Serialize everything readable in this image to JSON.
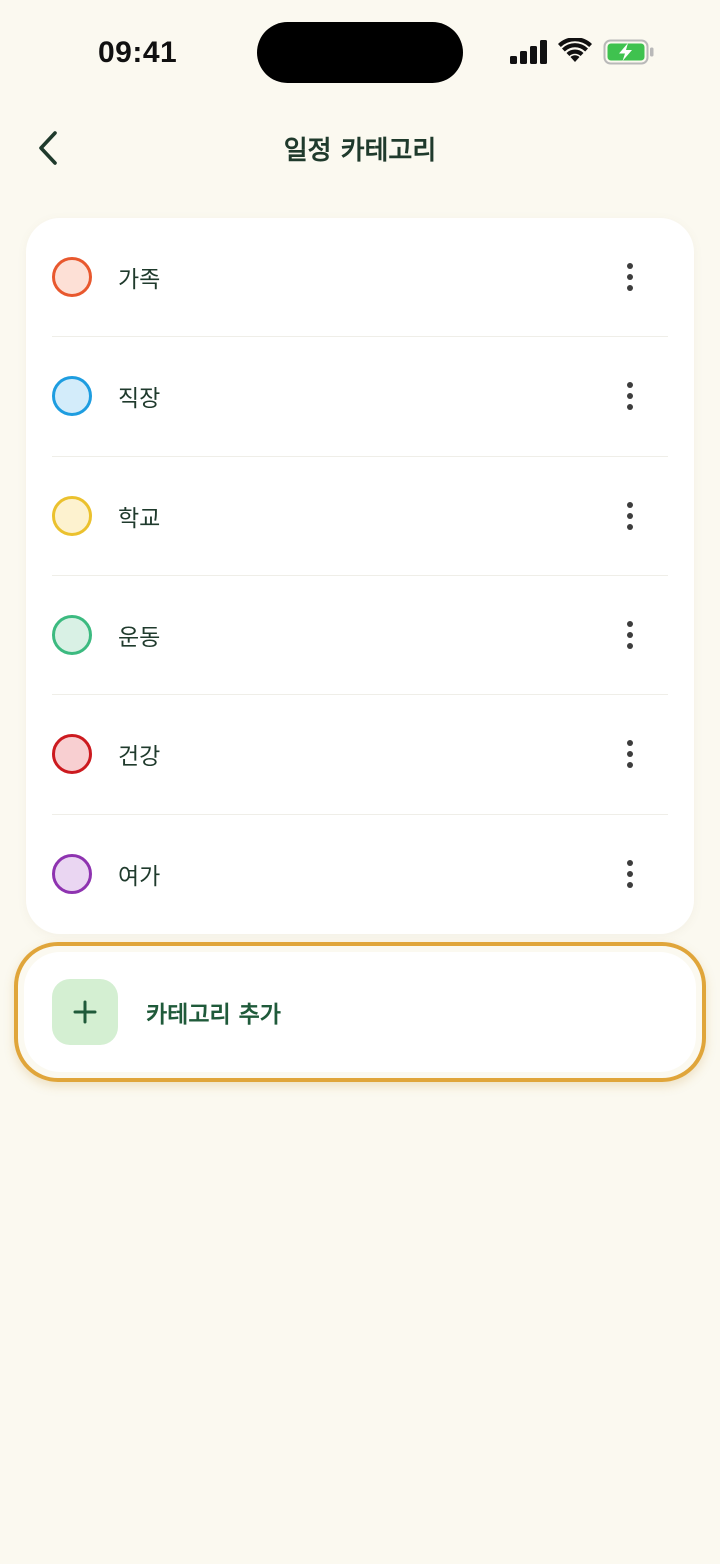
{
  "status_bar": {
    "time": "09:41",
    "icons": [
      "cellular-signal-icon",
      "wifi-icon",
      "battery-charging-icon"
    ]
  },
  "header": {
    "title": "일정 카테고리",
    "back_icon": "chevron-left-icon"
  },
  "categories": [
    {
      "name": "가족",
      "color": "#e8582e",
      "fill": "#fde0d6"
    },
    {
      "name": "직장",
      "color": "#1e9de0",
      "fill": "#d3ecfa"
    },
    {
      "name": "학교",
      "color": "#ebc12e",
      "fill": "#fdf2cf"
    },
    {
      "name": "운동",
      "color": "#3cba80",
      "fill": "#d9f1e5"
    },
    {
      "name": "건강",
      "color": "#cc1a1f",
      "fill": "#f8cfd1"
    },
    {
      "name": "여가",
      "color": "#8e33b0",
      "fill": "#ead6f2"
    }
  ],
  "add_category": {
    "label": "카테고리 추가",
    "icon": "plus-icon"
  },
  "colors": {
    "background": "#fbf9f0",
    "accent_highlight": "#e0a53a",
    "add_icon_bg": "#d4efd2",
    "text_primary": "#1f3a2c"
  }
}
